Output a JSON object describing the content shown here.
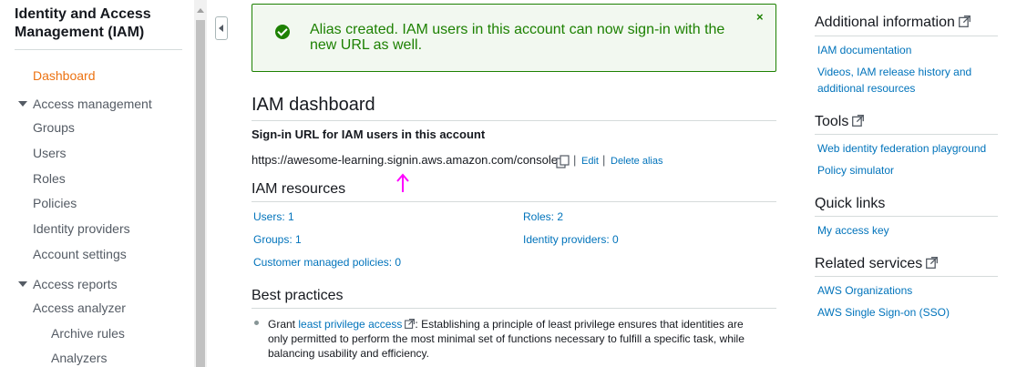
{
  "sidebar": {
    "title": "Identity and Access Management (IAM)",
    "dashboard": "Dashboard",
    "access_management": {
      "label": "Access management",
      "items": [
        "Groups",
        "Users",
        "Roles",
        "Policies",
        "Identity providers",
        "Account settings"
      ]
    },
    "access_reports": {
      "label": "Access reports",
      "items": [
        "Access analyzer"
      ],
      "sub_items": [
        "Archive rules",
        "Analyzers"
      ]
    }
  },
  "alert": {
    "message": "Alias created. IAM users in this account can now sign-in with the new URL as well.",
    "close": "×",
    "color": "#1d8102"
  },
  "main": {
    "title": "IAM dashboard",
    "signin": {
      "label": "Sign-in URL for IAM users in this account",
      "url": "https://awesome-learning.signin.aws.amazon.com/console",
      "edit": "Edit",
      "delete": "Delete alias"
    },
    "resources": {
      "title": "IAM resources",
      "left": [
        "Users: 1",
        "Groups: 1",
        "Customer managed policies: 0"
      ],
      "right": [
        "Roles: 2",
        "Identity providers: 0"
      ]
    },
    "best_practices": {
      "title": "Best practices",
      "prefix": "Grant ",
      "link": "least privilege access",
      "text": ": Establishing a principle of least privilege ensures that identities are only permitted to perform the most minimal set of functions necessary to fulfill a specific task, while balancing usability and efficiency."
    }
  },
  "right_panel": {
    "additional_info": {
      "title": "Additional information",
      "links": [
        "IAM documentation",
        "Videos, IAM release history and additional resources"
      ]
    },
    "tools": {
      "title": "Tools",
      "links": [
        "Web identity federation playground",
        "Policy simulator"
      ]
    },
    "quick_links": {
      "title": "Quick links",
      "links": [
        "My access key"
      ]
    },
    "related_services": {
      "title": "Related services",
      "links": [
        "AWS Organizations",
        "AWS Single Sign-on (SSO)"
      ]
    }
  },
  "colors": {
    "link": "#0073bb",
    "active": "#ec7211",
    "annotation": "#ff00ff"
  }
}
